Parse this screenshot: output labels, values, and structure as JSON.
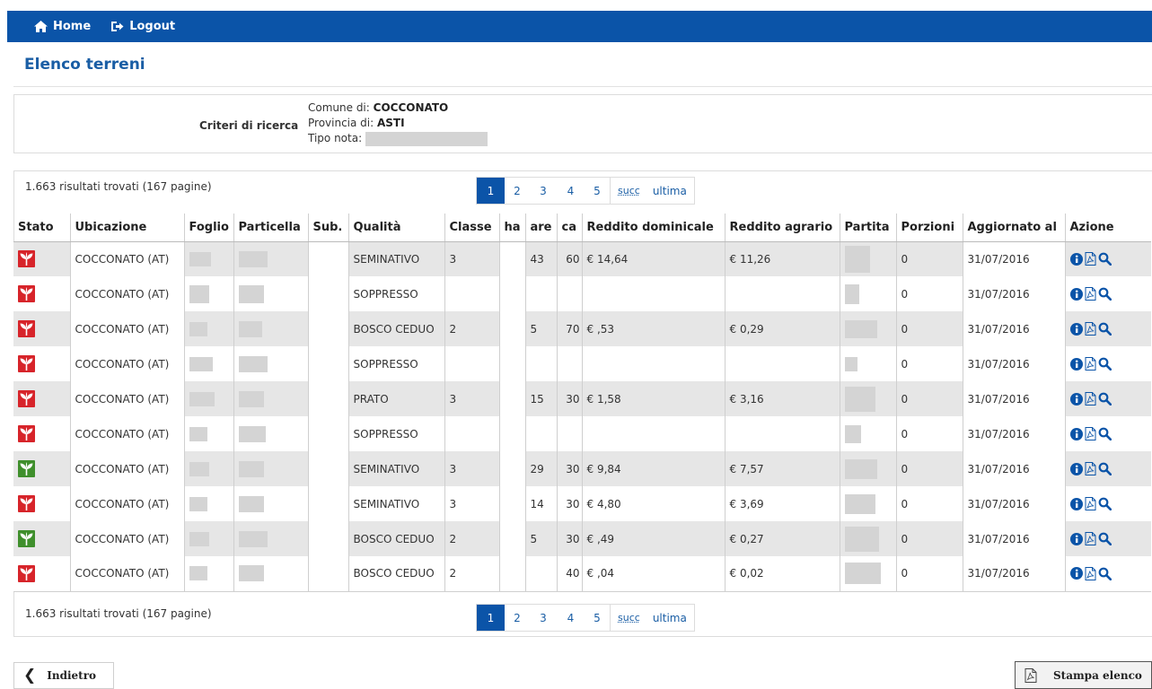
{
  "nav": {
    "home": "Home",
    "logout": "Logout"
  },
  "page": {
    "title": "Elenco terreni"
  },
  "criteria": {
    "label": "Criteri di ricerca",
    "comune_label": "Comune di:",
    "comune_value": "COCCONATO",
    "provincia_label": "Provincia di:",
    "provincia_value": "ASTI",
    "tipo_label": "Tipo nota:"
  },
  "results": {
    "count_text": "1.663 risultati trovati (167 pagine)"
  },
  "pagination": {
    "pages": [
      "1",
      "2",
      "3",
      "4",
      "5"
    ],
    "next": "succ",
    "last": "ultima",
    "active": "1"
  },
  "table": {
    "headers": [
      "Stato",
      "Ubicazione",
      "Foglio",
      "Particella",
      "Sub.",
      "Qualità",
      "Classe",
      "ha",
      "are",
      "ca",
      "Reddito dominicale",
      "Reddito agrario",
      "Partita",
      "Porzioni",
      "Aggiornato al",
      "Azione"
    ],
    "rows": [
      {
        "stato": "red",
        "ubicazione": "COCCONATO (AT)",
        "qualita": "SEMINATIVO",
        "classe": "3",
        "ha": "",
        "are": "43",
        "ca": "60",
        "dom": "€ 14,64",
        "agr": "€ 11,26",
        "porzioni": "0",
        "aggiornato": "31/07/2016"
      },
      {
        "stato": "red",
        "ubicazione": "COCCONATO (AT)",
        "qualita": "SOPPRESSO",
        "classe": "",
        "ha": "",
        "are": "",
        "ca": "",
        "dom": "",
        "agr": "",
        "porzioni": "0",
        "aggiornato": "31/07/2016"
      },
      {
        "stato": "red",
        "ubicazione": "COCCONATO (AT)",
        "qualita": "BOSCO CEDUO",
        "classe": "2",
        "ha": "",
        "are": "5",
        "ca": "70",
        "dom": "€ ,53",
        "agr": "€ 0,29",
        "porzioni": "0",
        "aggiornato": "31/07/2016"
      },
      {
        "stato": "red",
        "ubicazione": "COCCONATO (AT)",
        "qualita": "SOPPRESSO",
        "classe": "",
        "ha": "",
        "are": "",
        "ca": "",
        "dom": "",
        "agr": "",
        "porzioni": "0",
        "aggiornato": "31/07/2016"
      },
      {
        "stato": "red",
        "ubicazione": "COCCONATO (AT)",
        "qualita": "PRATO",
        "classe": "3",
        "ha": "",
        "are": "15",
        "ca": "30",
        "dom": "€ 1,58",
        "agr": "€ 3,16",
        "porzioni": "0",
        "aggiornato": "31/07/2016"
      },
      {
        "stato": "red",
        "ubicazione": "COCCONATO (AT)",
        "qualita": "SOPPRESSO",
        "classe": "",
        "ha": "",
        "are": "",
        "ca": "",
        "dom": "",
        "agr": "",
        "porzioni": "0",
        "aggiornato": "31/07/2016"
      },
      {
        "stato": "green",
        "ubicazione": "COCCONATO (AT)",
        "qualita": "SEMINATIVO",
        "classe": "3",
        "ha": "",
        "are": "29",
        "ca": "30",
        "dom": "€ 9,84",
        "agr": "€ 7,57",
        "porzioni": "0",
        "aggiornato": "31/07/2016"
      },
      {
        "stato": "red",
        "ubicazione": "COCCONATO (AT)",
        "qualita": "SEMINATIVO",
        "classe": "3",
        "ha": "",
        "are": "14",
        "ca": "30",
        "dom": "€ 4,80",
        "agr": "€ 3,69",
        "porzioni": "0",
        "aggiornato": "31/07/2016"
      },
      {
        "stato": "green",
        "ubicazione": "COCCONATO (AT)",
        "qualita": "BOSCO CEDUO",
        "classe": "2",
        "ha": "",
        "are": "5",
        "ca": "30",
        "dom": "€ ,49",
        "agr": "€ 0,27",
        "porzioni": "0",
        "aggiornato": "31/07/2016"
      },
      {
        "stato": "red",
        "ubicazione": "COCCONATO (AT)",
        "qualita": "BOSCO CEDUO",
        "classe": "2",
        "ha": "",
        "are": "",
        "ca": "40",
        "dom": "€ ,04",
        "agr": "€ 0,02",
        "porzioni": "0",
        "aggiornato": "31/07/2016"
      }
    ]
  },
  "icons": {
    "status_red_color": "#d7242a",
    "status_green_color": "#3f8f2c",
    "action_color": "#0b54a8",
    "home": "home-icon",
    "logout": "logout-icon",
    "info": "info-icon",
    "pdf": "pdf-icon",
    "search": "search-icon"
  },
  "buttons": {
    "back": "Indietro",
    "print": "Stampa elenco"
  }
}
